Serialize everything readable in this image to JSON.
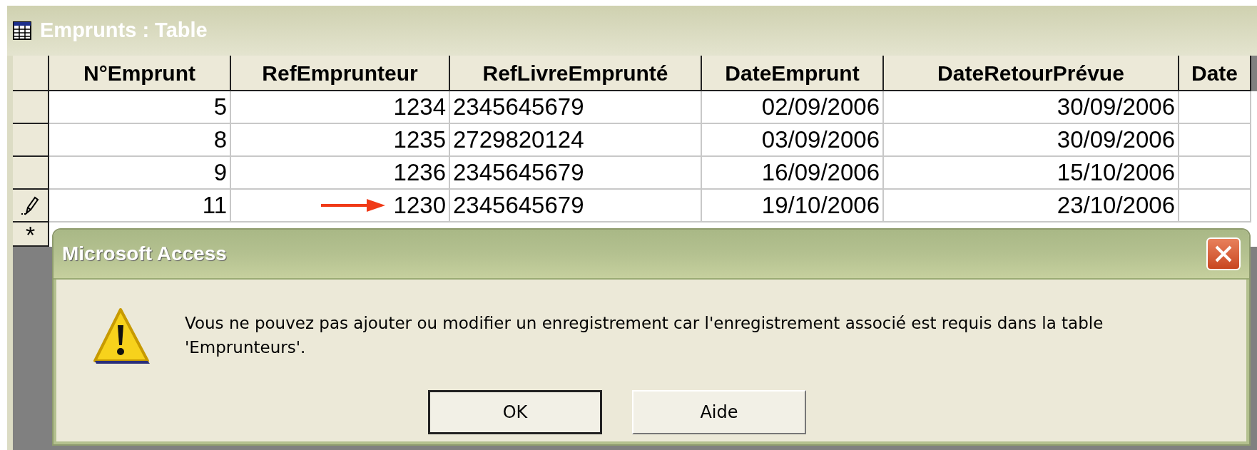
{
  "window": {
    "title": "Emprunts : Table"
  },
  "table": {
    "columns": [
      {
        "label": "N°Emprunt",
        "kind": "number"
      },
      {
        "label": "RefEmprunteur",
        "kind": "number"
      },
      {
        "label": "RefLivreEmprunté",
        "kind": "text"
      },
      {
        "label": "DateEmprunt",
        "kind": "number"
      },
      {
        "label": "DateRetourPrévue",
        "kind": "number"
      },
      {
        "label": "Date",
        "kind": "number"
      }
    ],
    "rows": [
      {
        "editing": false,
        "marked": false,
        "cells": [
          "5",
          "1234",
          "2345645679",
          "02/09/2006",
          "30/09/2006"
        ]
      },
      {
        "editing": false,
        "marked": false,
        "cells": [
          "8",
          "1235",
          "2729820124",
          "03/09/2006",
          "30/09/2006"
        ]
      },
      {
        "editing": false,
        "marked": false,
        "cells": [
          "9",
          "1236",
          "2345645679",
          "16/09/2006",
          "15/10/2006"
        ]
      },
      {
        "editing": true,
        "marked": true,
        "cells": [
          "11",
          "1230",
          "2345645679",
          "19/10/2006",
          "23/10/2006"
        ]
      }
    ],
    "new_row": {
      "marker": "*"
    }
  },
  "dialog": {
    "title": "Microsoft Access",
    "message": "Vous ne pouvez pas ajouter ou modifier un enregistrement car l'enregistrement associé est requis dans la table 'Emprunteurs'.",
    "buttons": [
      "OK",
      "Aide"
    ]
  }
}
